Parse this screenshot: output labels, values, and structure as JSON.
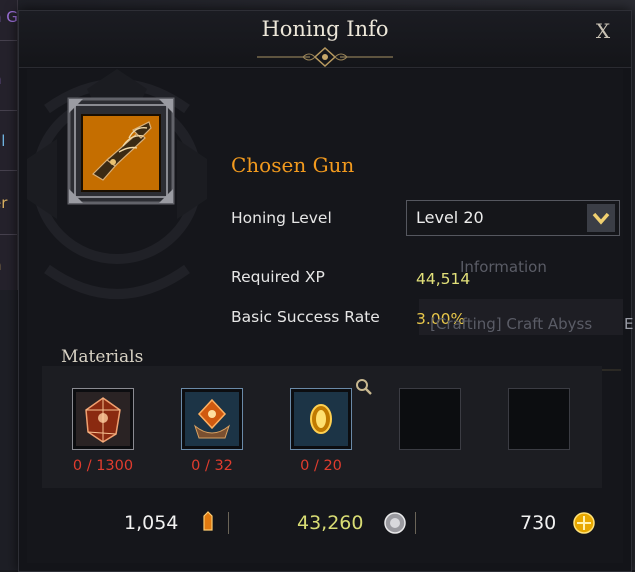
{
  "background": {
    "side_items": [
      "n Gun",
      "n",
      "al",
      "er",
      "n"
    ],
    "right_text_1": "Information",
    "right_text_2": "[Crafting] Craft Abyss",
    "right_text_3": "E"
  },
  "dialog": {
    "title": "Honing Info",
    "close_label": "X"
  },
  "item": {
    "name": "Chosen Gun",
    "icon": "gun-icon"
  },
  "fields": {
    "honing_level_label": "Honing Level",
    "honing_level_value": "Level 20",
    "required_xp_label": "Required XP",
    "required_xp_value": "44,514",
    "success_rate_label": "Basic Success Rate",
    "success_rate_value": "3.00%"
  },
  "materials": {
    "title": "Materials",
    "slots": [
      {
        "icon": "red-crystal-icon",
        "count": "0 / 1300"
      },
      {
        "icon": "orange-gem-icon",
        "count": "0 / 32"
      },
      {
        "icon": "gold-ring-icon",
        "count": "0 / 20"
      },
      {
        "icon": "empty-slot",
        "count": ""
      },
      {
        "icon": "empty-slot",
        "count": ""
      }
    ]
  },
  "currencies": {
    "shards": "1,054",
    "silver": "43,260",
    "gold": "730"
  },
  "colors": {
    "item_name": "#f29a1e",
    "material_count": "#e03c2e",
    "value_yellow": "#e2e07a"
  }
}
